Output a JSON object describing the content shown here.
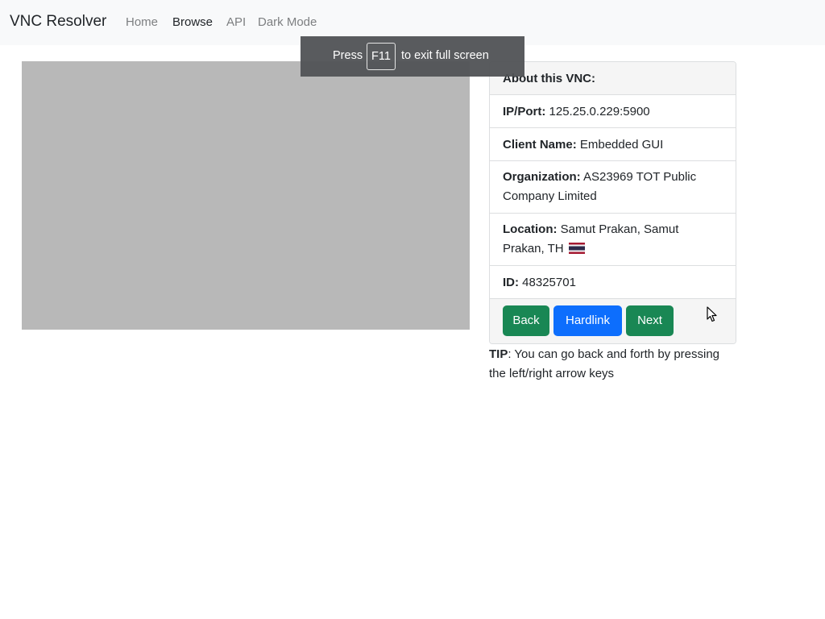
{
  "navbar": {
    "brand": "VNC Resolver",
    "links": [
      "Home",
      "Browse",
      "API",
      "Dark Mode"
    ],
    "active": "Browse"
  },
  "fullscreen_toast": {
    "prefix": "Press",
    "key": "F11",
    "suffix": "to exit full screen"
  },
  "info_card": {
    "header": "About this VNC:",
    "ip_label": "IP/Port:",
    "ip_value": "125.25.0.229:5900",
    "client_label": "Client Name:",
    "client_value": "Embedded GUI",
    "org_label": "Organization:",
    "org_value": "AS23969 TOT Public Company Limited",
    "location_label": "Location:",
    "location_value": "Samut Prakan, Samut Prakan, TH",
    "location_flag": "thailand-flag-icon",
    "id_label": "ID:",
    "id_value": "48325701"
  },
  "buttons": {
    "back": "Back",
    "hardlink": "Hardlink",
    "next": "Next"
  },
  "colors": {
    "green": "#198754",
    "blue": "#0d6efd",
    "placeholder_gray": "#b8b8b8"
  },
  "tip": {
    "label": "TIP",
    "text": ": You can go back and forth by pressing the left/right arrow keys"
  }
}
